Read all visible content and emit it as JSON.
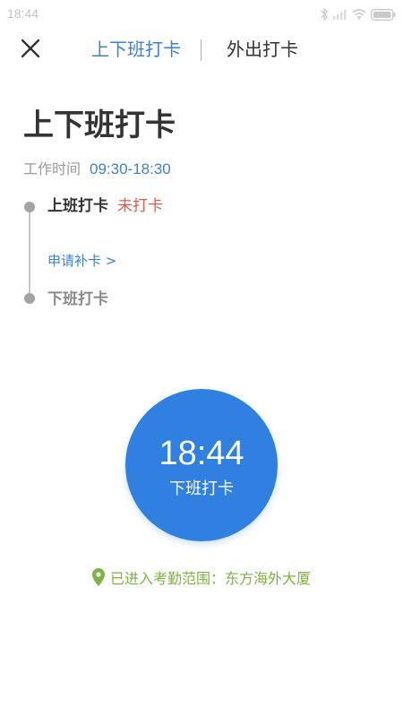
{
  "status_bar": {
    "time": "18:44",
    "icons": [
      "bluetooth-icon",
      "signal-icon",
      "wifi-icon",
      "battery-icon"
    ]
  },
  "nav": {
    "close_icon": "close-icon",
    "tabs": [
      {
        "label": "上下班打卡",
        "active": true
      },
      {
        "label": "外出打卡",
        "active": false
      }
    ]
  },
  "page": {
    "title": "上下班打卡",
    "work_hours_label": "工作时间",
    "work_hours_value": "09:30-18:30"
  },
  "timeline": {
    "clock_in": {
      "label": "上班打卡",
      "status": "未打卡"
    },
    "reapply_link": "申请补卡 >",
    "clock_out": {
      "label": "下班打卡"
    }
  },
  "punch": {
    "time": "18:44",
    "label": "下班打卡"
  },
  "location": {
    "icon": "location-pin-icon",
    "text": "已进入考勤范围：东方海外大厦"
  },
  "colors": {
    "accent": "#2f80e0",
    "link": "#3b82d6",
    "warning": "#e05a4f",
    "location": "#7cb342"
  }
}
